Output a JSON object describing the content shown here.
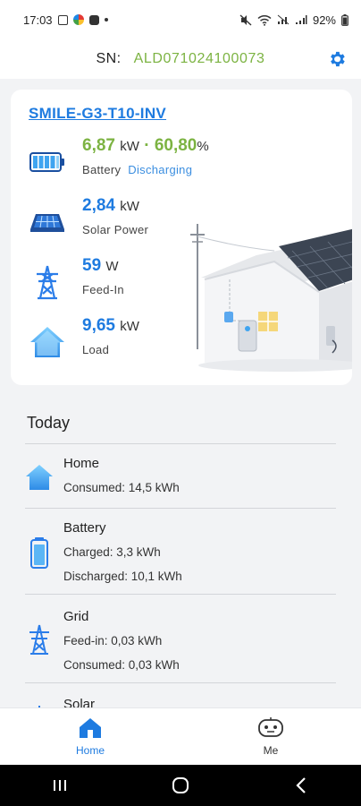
{
  "status_bar": {
    "time": "17:03",
    "battery_percent": "92%"
  },
  "header": {
    "sn_label": "SN:",
    "sn_value": "ALD071024100073",
    "settings_icon": "gear-icon"
  },
  "device": {
    "name": "SMILE-G3-T10-INV",
    "battery": {
      "value": "6,87",
      "unit": "kW",
      "separator": "·",
      "soc": "60,80",
      "soc_unit": "%",
      "label": "Battery",
      "status": "Discharging"
    },
    "solar": {
      "value": "2,84",
      "unit": "kW",
      "label": "Solar Power"
    },
    "feed_in": {
      "value": "59",
      "unit": "W",
      "label": "Feed-In"
    },
    "load": {
      "value": "9,65",
      "unit": "kW",
      "label": "Load"
    }
  },
  "today": {
    "title": "Today",
    "home": {
      "title": "Home",
      "consumed": "Consumed: 14,5 kWh"
    },
    "battery": {
      "title": "Battery",
      "charged": "Charged: 3,3 kWh",
      "discharged": "Discharged: 10,1 kWh"
    },
    "grid": {
      "title": "Grid",
      "feed_in": "Feed-in: 0,03 kWh",
      "consumed": "Consumed: 0,03 kWh"
    },
    "solar": {
      "title": "Solar"
    }
  },
  "bottom_nav": {
    "items": [
      {
        "label": "Home",
        "icon": "home-icon",
        "active": true
      },
      {
        "label": "Me",
        "icon": "robot-face-icon",
        "active": false
      }
    ]
  },
  "system_nav": {
    "recents": "recents-icon",
    "home": "home-circle-icon",
    "back": "back-icon"
  },
  "colors": {
    "accent": "#1e7be0",
    "green": "#7cb342",
    "background": "#f2f3f5"
  }
}
